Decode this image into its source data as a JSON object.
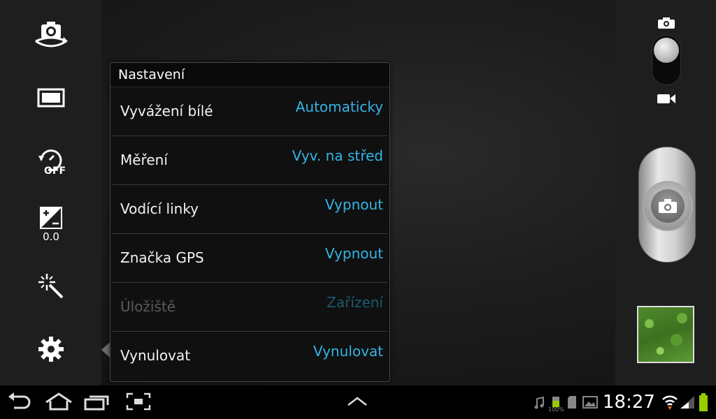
{
  "left_toolbar": {
    "items": [
      {
        "name": "self-shot-toggle",
        "icon": "camera-switch-icon"
      },
      {
        "name": "aspect-ratio",
        "icon": "rectangle-icon"
      },
      {
        "name": "timer",
        "icon": "timer-off-icon"
      },
      {
        "name": "exposure",
        "icon": "exposure-icon",
        "value": "0.0"
      },
      {
        "name": "effects",
        "icon": "magic-wand-icon"
      },
      {
        "name": "settings",
        "icon": "gear-icon"
      }
    ]
  },
  "settings": {
    "title": "Nastavení",
    "rows": [
      {
        "label": "Vyvážení bílé",
        "value": "Automaticky",
        "enabled": true
      },
      {
        "label": "Měření",
        "value": "Vyv. na střed",
        "enabled": true
      },
      {
        "label": "Vodící linky",
        "value": "Vypnout",
        "enabled": true
      },
      {
        "label": "Značka GPS",
        "value": "Vypnout",
        "enabled": true
      },
      {
        "label": "Úložiště",
        "value": "Zařízení",
        "enabled": false
      },
      {
        "label": "Vynulovat",
        "value": "Vynulovat",
        "enabled": true
      }
    ]
  },
  "right_controls": {
    "mode_icons": [
      "camera-icon",
      "video-camera-icon"
    ],
    "shutter_icon": "camera-icon"
  },
  "system_bar": {
    "time": "18:27",
    "battery_label": "100%",
    "nav_icons": [
      "back-icon",
      "home-icon",
      "recent-apps-icon",
      "screenshot-icon",
      "up-arrow-icon"
    ],
    "status_icons": [
      "music-icon",
      "battery-saver-icon",
      "sd-card-icon",
      "gallery-icon",
      "wifi-icon",
      "signal-icon",
      "battery-icon"
    ]
  },
  "colors": {
    "accent": "#33b5e5",
    "disabled_value": "#1d5a70",
    "battery": "#99cc00"
  }
}
